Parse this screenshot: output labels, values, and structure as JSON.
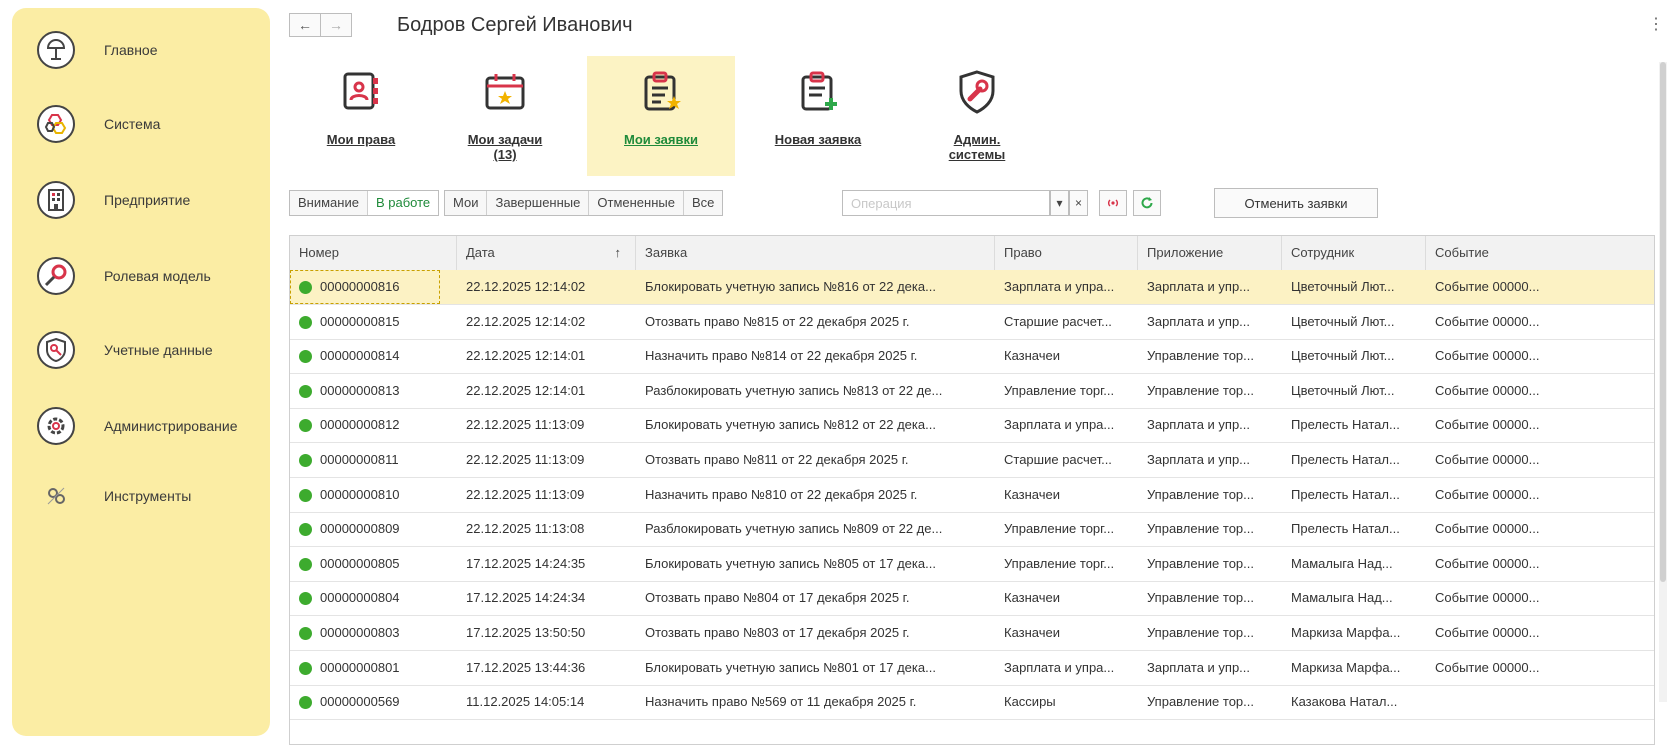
{
  "sidebar": {
    "items": [
      {
        "label": "Главное",
        "icon": "desk-lamp-icon"
      },
      {
        "label": "Система",
        "icon": "hexagons-icon"
      },
      {
        "label": "Предприятие",
        "icon": "building-icon"
      },
      {
        "label": "Ролевая модель",
        "icon": "key-icon"
      },
      {
        "label": "Учетные данные",
        "icon": "shield-key-icon"
      },
      {
        "label": "Администрирование",
        "icon": "gear-icon"
      },
      {
        "label": "Инструменты",
        "icon": "tools-icon"
      }
    ]
  },
  "header": {
    "title": "Бодров Сергей Иванович",
    "back": "←",
    "forward": "→",
    "more": "⋮"
  },
  "actions": [
    {
      "label": "Мои права",
      "icon": "contact-book-icon",
      "active": false
    },
    {
      "label": "Мои задачи",
      "label2": "(13)",
      "icon": "calendar-icon",
      "active": false
    },
    {
      "label": "Мои заявки",
      "icon": "clipboard-star-icon",
      "active": true
    },
    {
      "label": "Новая заявка",
      "icon": "clipboard-plus-icon",
      "active": false
    },
    {
      "label": "Админ.",
      "label2": "системы",
      "icon": "shield-wrench-icon",
      "active": false
    }
  ],
  "filters": {
    "group1": [
      "Внимание",
      "В работе"
    ],
    "group2": [
      "Мои",
      "Завершенные",
      "Отмененные",
      "Все"
    ],
    "active": "В работе",
    "operation_placeholder": "Операция",
    "dropdown": "▾",
    "clear": "×",
    "cancel_button": "Отменить заявки"
  },
  "table": {
    "columns": [
      "Номер",
      "Дата",
      "Заявка",
      "Право",
      "Приложение",
      "Сотрудник",
      "Событие"
    ],
    "sort_indicator": "↑",
    "rows": [
      [
        "00000000816",
        "22.12.2025 12:14:02",
        "Блокировать учетную запись №816 от 22 дека...",
        "Зарплата и упра...",
        "Зарплата и упр...",
        "Цветочный Лют...",
        "Событие 00000..."
      ],
      [
        "00000000815",
        "22.12.2025 12:14:02",
        "Отозвать право №815 от 22 декабря 2025 г.",
        "Старшие расчет...",
        "Зарплата и упр...",
        "Цветочный Лют...",
        "Событие 00000..."
      ],
      [
        "00000000814",
        "22.12.2025 12:14:01",
        "Назначить право №814 от 22 декабря 2025 г.",
        "Казначеи",
        "Управление тор...",
        "Цветочный Лют...",
        "Событие 00000..."
      ],
      [
        "00000000813",
        "22.12.2025 12:14:01",
        "Разблокировать учетную запись №813 от 22 де...",
        "Управление торг...",
        "Управление тор...",
        "Цветочный Лют...",
        "Событие 00000..."
      ],
      [
        "00000000812",
        "22.12.2025 11:13:09",
        "Блокировать учетную запись №812 от 22 дека...",
        "Зарплата и упра...",
        "Зарплата и упр...",
        "Прелесть Натал...",
        "Событие 00000..."
      ],
      [
        "00000000811",
        "22.12.2025 11:13:09",
        "Отозвать право №811 от 22 декабря 2025 г.",
        "Старшие расчет...",
        "Зарплата и упр...",
        "Прелесть Натал...",
        "Событие 00000..."
      ],
      [
        "00000000810",
        "22.12.2025 11:13:09",
        "Назначить право №810 от 22 декабря 2025 г.",
        "Казначеи",
        "Управление тор...",
        "Прелесть Натал...",
        "Событие 00000..."
      ],
      [
        "00000000809",
        "22.12.2025 11:13:08",
        "Разблокировать учетную запись №809 от 22 де...",
        "Управление торг...",
        "Управление тор...",
        "Прелесть Натал...",
        "Событие 00000..."
      ],
      [
        "00000000805",
        "17.12.2025 14:24:35",
        "Блокировать учетную запись №805 от 17 дека...",
        "Управление торг...",
        "Управление тор...",
        "Мамалыга Над...",
        "Событие 00000..."
      ],
      [
        "00000000804",
        "17.12.2025 14:24:34",
        "Отозвать право №804 от 17 декабря 2025 г.",
        "Казначеи",
        "Управление тор...",
        "Мамалыга Над...",
        "Событие 00000..."
      ],
      [
        "00000000803",
        "17.12.2025 13:50:50",
        "Отозвать право №803 от 17 декабря 2025 г.",
        "Казначеи",
        "Управление тор...",
        "Маркиза Марфа...",
        "Событие 00000..."
      ],
      [
        "00000000801",
        "17.12.2025 13:44:36",
        "Блокировать учетную запись №801 от 17 дека...",
        "Зарплата и упра...",
        "Зарплата и упр...",
        "Маркиза Марфа...",
        "Событие 00000..."
      ],
      [
        "00000000569",
        "11.12.2025 14:05:14",
        "Назначить право №569 от 11 декабря 2025 г.",
        "Кассиры",
        "Управление тор...",
        "Казакова Натал...",
        ""
      ]
    ]
  },
  "colors": {
    "sidebar_bg": "#fbeda4",
    "accent_green": "#1f8a3a",
    "icon_red": "#d8344a",
    "status_green": "#3dab2e"
  }
}
